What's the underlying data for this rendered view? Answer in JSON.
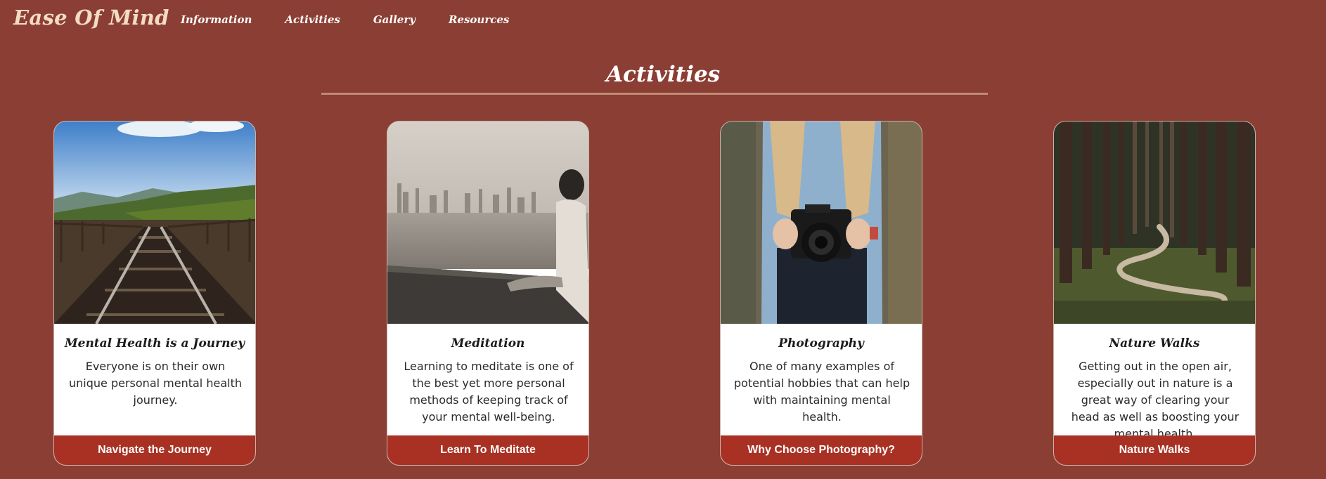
{
  "brand": "Ease Of Mind",
  "nav": [
    "Information",
    "Activities",
    "Gallery",
    "Resources"
  ],
  "section_title": "Activities",
  "cards": [
    {
      "title": "Mental Health is a Journey",
      "description": "Everyone is on their own unique personal mental health journey.",
      "button": "Navigate the Journey",
      "image": "railway-track-photo"
    },
    {
      "title": "Meditation",
      "description": "Learning to meditate is one of the best yet more personal methods of keeping track of your mental well-being.",
      "button": "Learn To Meditate",
      "image": "person-by-water-photo"
    },
    {
      "title": "Photography",
      "description": "One of many examples of potential hobbies that can help with maintaining mental health.",
      "button": "Why Choose Photography?",
      "image": "camera-holder-photo"
    },
    {
      "title": "Nature Walks",
      "description": "Getting out in the open air, especially out in nature is a great way of clearing your head as well as boosting your mental health.",
      "button": "Nature Walks",
      "image": "forest-path-photo"
    }
  ],
  "colors": {
    "background": "#8b3e33",
    "button": "#a83124",
    "brand_text": "#f3dcc3"
  }
}
